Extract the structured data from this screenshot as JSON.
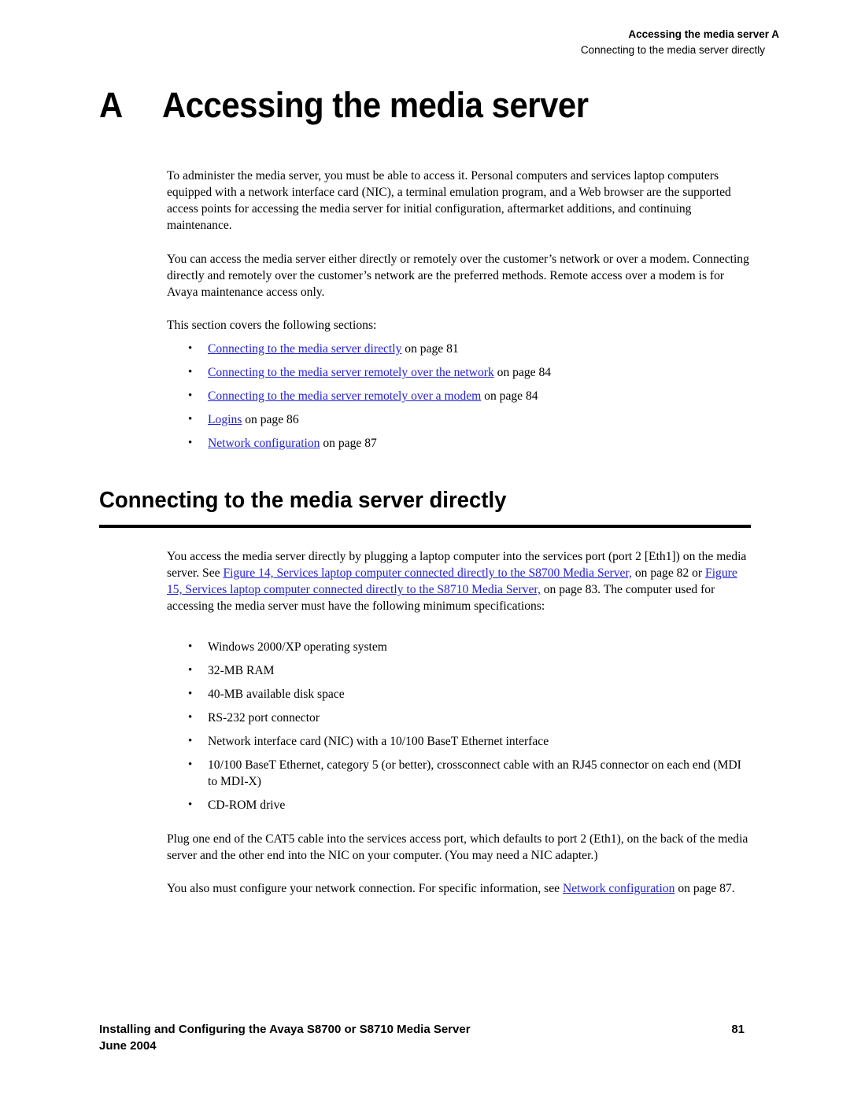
{
  "running_header": {
    "chapter": "Accessing the media server  A",
    "section": "Connecting to the media server directly"
  },
  "chapter": {
    "letter": "A",
    "title": "Accessing the media server"
  },
  "intro": {
    "paragraphs": [
      "To administer the media server, you must be able to access it. Personal computers and services laptop computers equipped with a network interface card (NIC), a terminal emulation program, and a Web browser are the supported access points for accessing the media server for initial configuration, aftermarket additions, and continuing maintenance.",
      "You can access the media server either directly or remotely over the customer’s network or over a modem. Connecting directly and remotely over the customer’s network are the preferred methods. Remote access over a modem is for Avaya maintenance access only.",
      "This section covers the following sections:"
    ],
    "toc": [
      {
        "link": "Connecting to the media server directly",
        "suffix": " on page 81"
      },
      {
        "link": "Connecting to the media server remotely over the network",
        "suffix": " on page 84"
      },
      {
        "link": "Connecting to the media server remotely over a modem",
        "suffix": " on page 84"
      },
      {
        "link": "Logins",
        "suffix": " on page 86"
      },
      {
        "link": "Network configuration",
        "suffix": " on page 87"
      }
    ]
  },
  "section": {
    "title": "Connecting to the media server directly",
    "para1": {
      "t1": "You access the media server directly by plugging a laptop computer into the services port (port 2 [Eth1]) on the media server. See ",
      "link1": "Figure 14, Services laptop computer connected directly to the S8700 Media Server,",
      "t2": " on page 82 or ",
      "link2": "Figure 15, Services laptop computer connected directly to the S8710 Media Server,",
      "t3": " on page 83. The computer used for accessing the media server must have the following minimum specifications:"
    },
    "requirements": [
      "Windows 2000/XP operating system",
      "32-MB RAM",
      "40-MB available disk space",
      "RS-232 port connector",
      "Network interface card (NIC) with a 10/100 BaseT Ethernet interface",
      "10/100 BaseT Ethernet, category 5 (or better), crossconnect cable with an RJ45 connector on each end (MDI to MDI-X)",
      "CD-ROM drive"
    ],
    "para2": "Plug one end of the CAT5 cable into the services access port, which defaults to port 2 (Eth1), on the back of the media server and the other end into the NIC on your computer. (You may need a NIC adapter.)",
    "para3": {
      "t1": "You also must configure your network connection. For specific information, see ",
      "link": "Network configuration",
      "t2": " on page 87."
    }
  },
  "footer": {
    "title": "Installing and Configuring the Avaya S8700 or S8710 Media Server",
    "date": "June 2004",
    "page_number": "81"
  },
  "colors": {
    "link": "#1f1fd8",
    "text": "#000000",
    "background": "#ffffff"
  }
}
